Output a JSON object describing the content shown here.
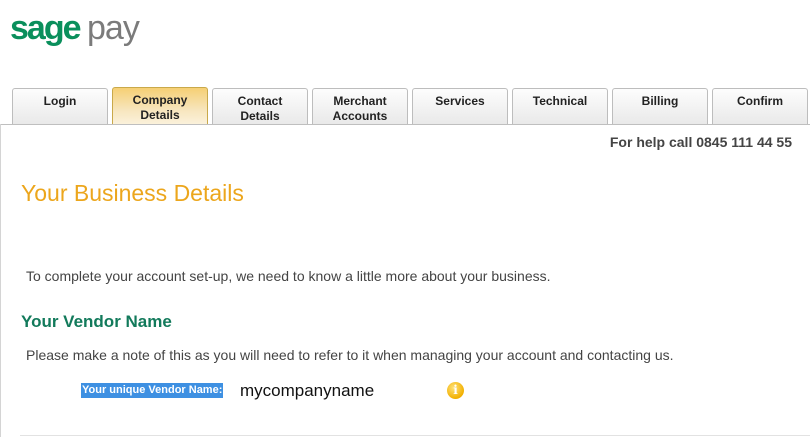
{
  "logo": {
    "part1": "sage",
    "part2": "pay"
  },
  "tabs": [
    {
      "label": "Login",
      "active": false
    },
    {
      "label": "Company\nDetails",
      "active": true
    },
    {
      "label": "Contact\nDetails",
      "active": false
    },
    {
      "label": "Merchant\nAccounts",
      "active": false
    },
    {
      "label": "Services",
      "active": false
    },
    {
      "label": "Technical",
      "active": false
    },
    {
      "label": "Billing",
      "active": false
    },
    {
      "label": "Confirm",
      "active": false
    }
  ],
  "help_text": "For help call 0845 111 44 55",
  "page_title": "Your Business Details",
  "intro_text": "To complete your account set-up, we need to know a little more about your business.",
  "section_title": "Your Vendor Name",
  "note_text": "Please make a note of this as you will need to refer to it when managing your account and contacting us.",
  "vendor": {
    "label": "Your unique Vendor Name:",
    "value": "mycompanyname",
    "info_icon": "info-icon"
  },
  "colors": {
    "brand_green": "#0a8f5c",
    "accent_orange": "#eca61c",
    "section_green": "#127a5b",
    "highlight_blue": "#3e90e2"
  }
}
